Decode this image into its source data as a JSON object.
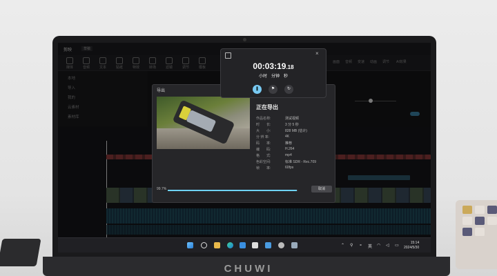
{
  "laptop": {
    "brand": "CHUWI"
  },
  "editor": {
    "app_title": "剪映",
    "tab": "草稿",
    "toolbar": [
      "媒体",
      "音频",
      "文本",
      "贴纸",
      "特效",
      "转场",
      "滤镜",
      "调节",
      "模板"
    ],
    "left_panel": [
      "本地",
      "导入",
      "我的",
      "云素材",
      "素材库"
    ],
    "right_panel": [
      "画面",
      "音频",
      "变速",
      "动画",
      "调节",
      "AI效果"
    ]
  },
  "export_dialog": {
    "title": "导出",
    "heading": "正在导出",
    "rows": [
      {
        "label": "作品名称:",
        "value": "测试视频"
      },
      {
        "label": "时　　长:",
        "value": "3 分 5 秒"
      },
      {
        "label": "大　　小:",
        "value": "828 MB (估计)"
      },
      {
        "label": "分 辨 率:",
        "value": "4K"
      },
      {
        "label": "码　　率:",
        "value": "推荐"
      },
      {
        "label": "编　　码:",
        "value": "H.264"
      },
      {
        "label": "格　　式:",
        "value": "mp4"
      },
      {
        "label": "色彩空间:",
        "value": "标准 SDR - Rec.709"
      },
      {
        "label": "帧　　率:",
        "value": "60fps"
      }
    ],
    "progress_text": "99.7%",
    "progress": 0.997,
    "cancel_label": "取消"
  },
  "recorder": {
    "time_main": "00:03:19",
    "time_frac": ".18",
    "units": "小时　分钟　秒"
  },
  "taskbar": {
    "tray_lang": "英",
    "time": "15:14",
    "date": "2024/5/30"
  },
  "colors": {
    "accent": "#6fd3ff",
    "record_button": "#78c9f2"
  }
}
